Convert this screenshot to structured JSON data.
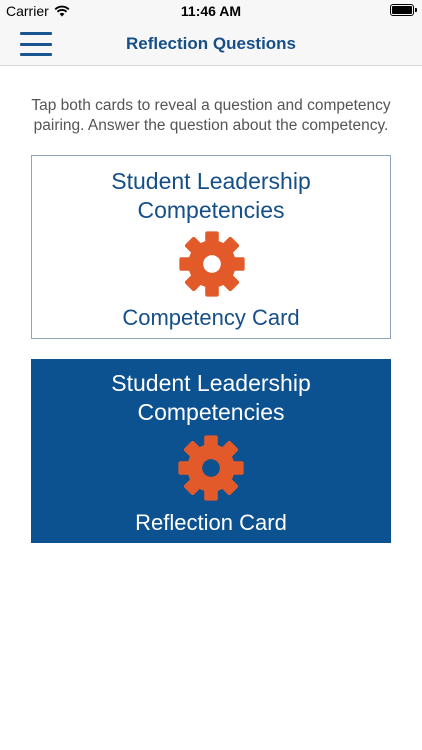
{
  "status_bar": {
    "carrier": "Carrier",
    "time": "11:46 AM",
    "battery_level": 1.0
  },
  "nav": {
    "title": "Reflection Questions",
    "menu_icon": "hamburger-menu-icon"
  },
  "instructions": "Tap both cards to reveal a question and competency pairing. Answer the question about the competency.",
  "cards": [
    {
      "heading_line1": "Student Leadership",
      "heading_line2": "Competencies",
      "label": "Competency Card",
      "icon": "gear-icon"
    },
    {
      "heading_line1": "Student Leadership",
      "heading_line2": "Competencies",
      "label": "Reflection Card",
      "icon": "gear-icon"
    }
  ],
  "colors": {
    "brand_blue": "#164f87",
    "card_blue": "#0c5190",
    "gear_orange": "#e25a2a",
    "text_gray": "#555555"
  }
}
